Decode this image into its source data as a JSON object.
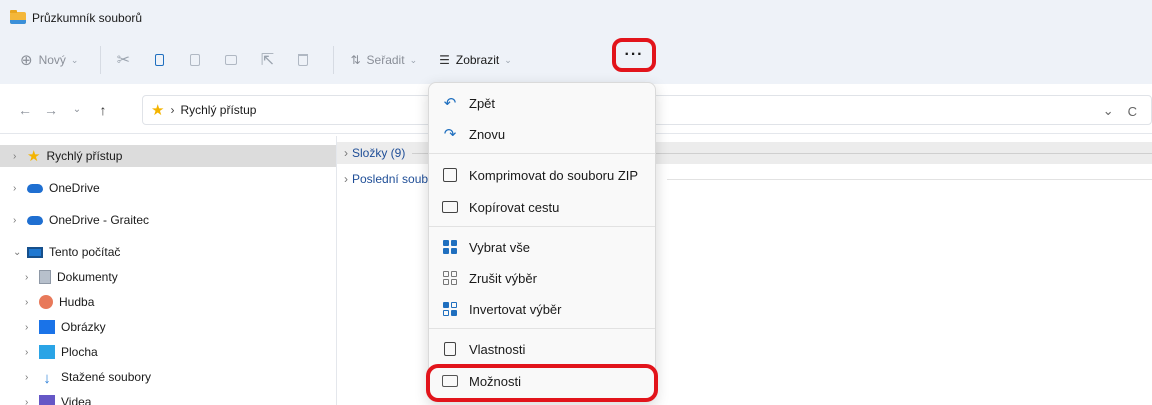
{
  "window": {
    "title": "Průzkumník souborů"
  },
  "toolbar": {
    "new_label": "Nový",
    "sort_label": "Seřadit",
    "view_label": "Zobrazit",
    "more_label": "···",
    "icons": [
      "new-icon",
      "cut-icon",
      "copy-icon",
      "paste-icon",
      "rename-icon",
      "share-icon",
      "delete-icon",
      "sort-icon",
      "view-icon"
    ]
  },
  "address": {
    "path": "Rychlý přístup",
    "separator": "›"
  },
  "sidebar": {
    "items": [
      {
        "label": "Rychlý přístup",
        "icon": "star-icon",
        "selected": true
      },
      {
        "label": "OneDrive",
        "icon": "cloud-icon"
      },
      {
        "label": "OneDrive - Graitec",
        "icon": "cloud-icon"
      },
      {
        "label": "Tento počítač",
        "icon": "pc-icon",
        "expanded": true
      },
      {
        "label": "Dokumenty",
        "icon": "documents-icon"
      },
      {
        "label": "Hudba",
        "icon": "music-icon"
      },
      {
        "label": "Obrázky",
        "icon": "pictures-icon"
      },
      {
        "label": "Plocha",
        "icon": "desktop-icon"
      },
      {
        "label": "Stažené soubory",
        "icon": "downloads-icon"
      },
      {
        "label": "Videa",
        "icon": "videos-icon"
      }
    ]
  },
  "main": {
    "groups": [
      {
        "label": "Složky (9)"
      },
      {
        "label": "Poslední soub"
      }
    ]
  },
  "context_menu": {
    "items": [
      {
        "label": "Zpět",
        "icon": "undo-icon"
      },
      {
        "label": "Znovu",
        "icon": "redo-icon"
      },
      {
        "label": "Komprimovat do souboru ZIP",
        "icon": "zip-icon"
      },
      {
        "label": "Kopírovat cestu",
        "icon": "copy-path-icon"
      },
      {
        "label": "Vybrat vše",
        "icon": "select-all-icon"
      },
      {
        "label": "Zrušit výběr",
        "icon": "select-none-icon"
      },
      {
        "label": "Invertovat výběr",
        "icon": "invert-selection-icon"
      },
      {
        "label": "Vlastnosti",
        "icon": "properties-icon"
      },
      {
        "label": "Možnosti",
        "icon": "options-icon"
      }
    ]
  },
  "colors": {
    "highlight": "#e2141b",
    "accent": "#1f6fbf",
    "toolbar_bg": "#eef2f8"
  }
}
